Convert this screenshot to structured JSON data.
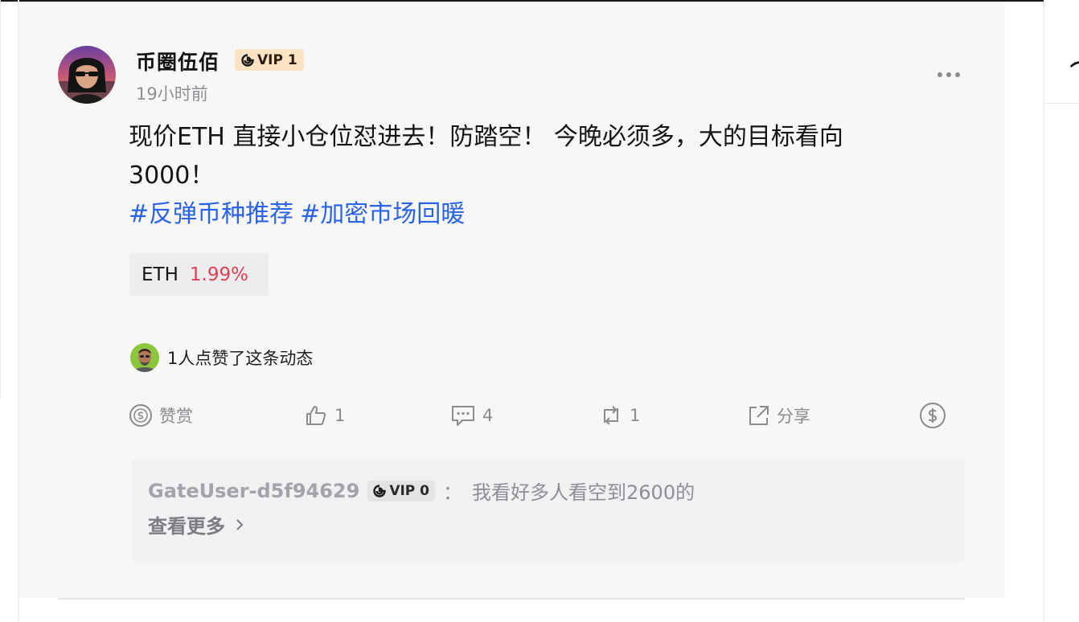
{
  "post": {
    "author": {
      "name": "币圈伍佰",
      "vip_label": "VIP 1",
      "avatar_icon": "avatar-sunglasses"
    },
    "time_ago": "19小时前",
    "text": "现价ETH 直接小仓位怼进去！防踏空！ 今晚必须多，大的目标看向3000！",
    "hashtags": [
      "#反弹币种推荐",
      "#加密市场回暖"
    ],
    "ticker": {
      "symbol": "ETH",
      "change": "1.99%",
      "change_color": "#e04152"
    },
    "likers_text": "1人点赞了这条动态",
    "actions": {
      "tip_label": "赞赏",
      "like_count": "1",
      "comment_count": "4",
      "repost_count": "1",
      "share_label": "分享"
    },
    "top_comment": {
      "user": "GateUser-d5f94629",
      "vip_label": "VIP 0",
      "colon": "：",
      "text": "我看好多人看空到2600的"
    },
    "view_more_label": "查看更多"
  },
  "colors": {
    "hashtag": "#2a63e6",
    "vip_badge_bg": "#fbe3c4",
    "card_bg": "#f7f7f8"
  }
}
